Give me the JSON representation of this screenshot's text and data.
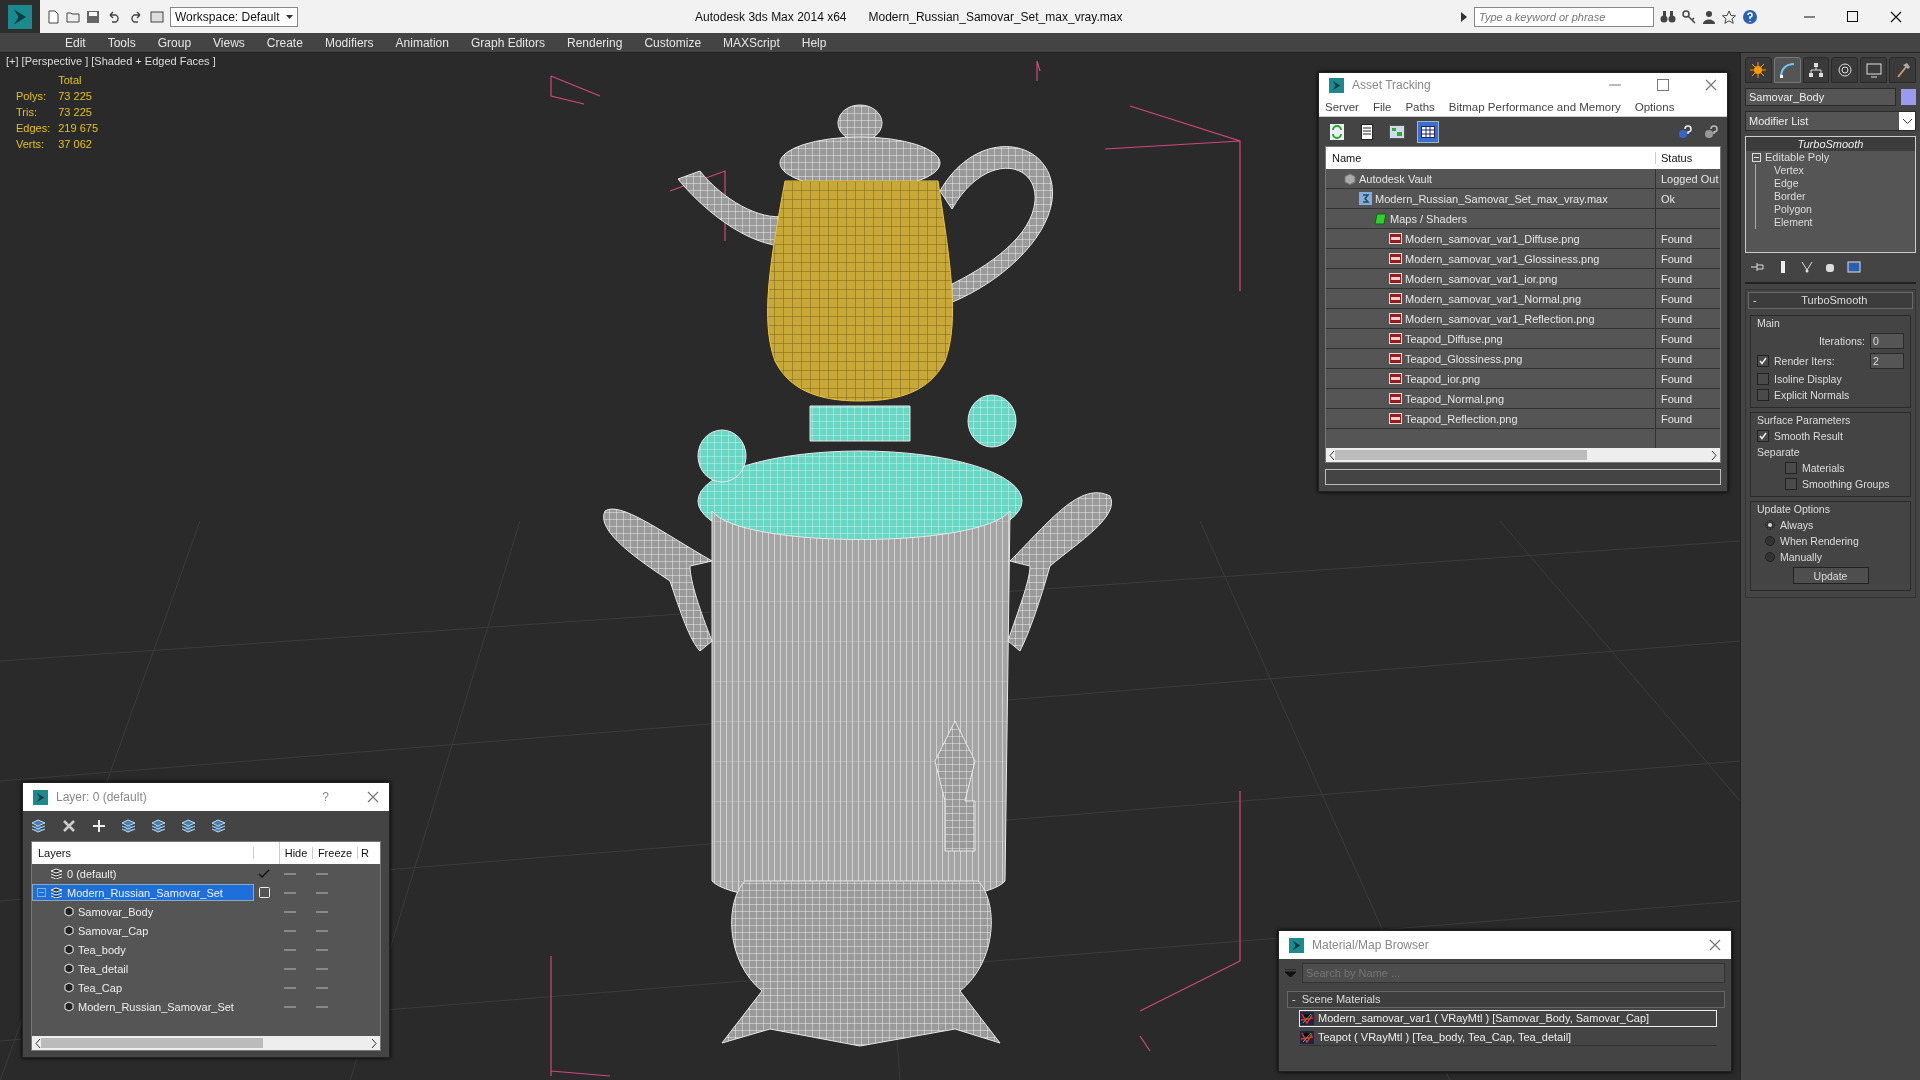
{
  "app": {
    "title": "Autodesk 3ds Max  2014 x64",
    "file": "Modern_Russian_Samovar_Set_max_vray.max",
    "workspace": "Workspace: Default",
    "search_placeholder": "Type a keyword or phrase"
  },
  "menu": [
    "Edit",
    "Tools",
    "Group",
    "Views",
    "Create",
    "Modifiers",
    "Animation",
    "Graph Editors",
    "Rendering",
    "Customize",
    "MAXScript",
    "Help"
  ],
  "viewport": {
    "label": "[+] [Perspective ] [Shaded + Edged Faces ]",
    "stats_header": "Total",
    "stats": [
      {
        "label": "Polys:",
        "value": "73 225"
      },
      {
        "label": "Tris:",
        "value": "73 225"
      },
      {
        "label": "Edges:",
        "value": "219 675"
      },
      {
        "label": "Verts:",
        "value": "37 062"
      }
    ]
  },
  "asset_tracking": {
    "title": "Asset Tracking",
    "menu": [
      "Server",
      "File",
      "Paths",
      "Bitmap Performance and Memory",
      "Options"
    ],
    "columns": [
      "Name",
      "Status"
    ],
    "rows": [
      {
        "name": "Autodesk Vault",
        "status": "Logged Out",
        "kind": "vault",
        "children": [
          {
            "name": "Modern_Russian_Samovar_Set_max_vray.max",
            "status": "Ok",
            "kind": "scene",
            "children": [
              {
                "name": "Maps / Shaders",
                "kind": "folder",
                "children": [
                  {
                    "name": "Modern_samovar_var1_Diffuse.png",
                    "status": "Found",
                    "kind": "png"
                  },
                  {
                    "name": "Modern_samovar_var1_Glossiness.png",
                    "status": "Found",
                    "kind": "png"
                  },
                  {
                    "name": "Modern_samovar_var1_ior.png",
                    "status": "Found",
                    "kind": "png"
                  },
                  {
                    "name": "Modern_samovar_var1_Normal.png",
                    "status": "Found",
                    "kind": "png"
                  },
                  {
                    "name": "Modern_samovar_var1_Reflection.png",
                    "status": "Found",
                    "kind": "png"
                  },
                  {
                    "name": "Teapod_Diffuse.png",
                    "status": "Found",
                    "kind": "png"
                  },
                  {
                    "name": "Teapod_Glossiness.png",
                    "status": "Found",
                    "kind": "png"
                  },
                  {
                    "name": "Teapod_ior.png",
                    "status": "Found",
                    "kind": "png"
                  },
                  {
                    "name": "Teapod_Normal.png",
                    "status": "Found",
                    "kind": "png"
                  },
                  {
                    "name": "Teapod_Reflection.png",
                    "status": "Found",
                    "kind": "png"
                  }
                ]
              }
            ]
          }
        ]
      }
    ]
  },
  "command_panel": {
    "tabs": [
      {
        "selected": false
      },
      {
        "selected": true
      },
      {
        "selected": false
      },
      {
        "selected": false
      },
      {
        "selected": false
      },
      {
        "selected": false
      }
    ],
    "object_name": "Samovar_Body",
    "modifier_list": "Modifier List",
    "stack": [
      {
        "name": "TurboSmooth",
        "kind": "modifier"
      },
      {
        "name": "Editable Poly",
        "kind": "base",
        "expanded": true,
        "children": [
          {
            "name": "Vertex"
          },
          {
            "name": "Edge"
          },
          {
            "name": "Border"
          },
          {
            "name": "Polygon"
          },
          {
            "name": "Element"
          }
        ]
      }
    ],
    "turbosmooth": {
      "title": "TurboSmooth",
      "toggle": "-",
      "main": {
        "title": "Main",
        "iterations_label": "Iterations:",
        "iterations": "0",
        "render_iters": {
          "label": "Render Iters:",
          "checked": true,
          "value": "2"
        },
        "checks": [
          {
            "label": "Isoline Display",
            "checked": false
          },
          {
            "label": "Explicit Normals",
            "checked": false
          }
        ]
      },
      "surface": {
        "title": "Surface Parameters",
        "smooth": {
          "label": "Smooth Result",
          "checked": true
        },
        "separate": "Separate",
        "checks": [
          {
            "label": "Materials",
            "checked": false
          },
          {
            "label": "Smoothing Groups",
            "checked": false
          }
        ]
      },
      "update": {
        "title": "Update Options",
        "options": [
          {
            "label": "Always",
            "selected": true
          },
          {
            "label": "When Rendering",
            "selected": false
          },
          {
            "label": "Manually",
            "selected": false
          }
        ],
        "button": "Update"
      }
    }
  },
  "layers": {
    "title": "Layer: 0 (default)",
    "help": "?",
    "columns": [
      "Layers",
      "Hide",
      "Freeze",
      "R"
    ],
    "rows": [
      {
        "name": "0 (default)",
        "selected": false,
        "current": true
      },
      {
        "name": "Modern_Russian_Samovar_Set",
        "selected": true,
        "current": false,
        "expanded": true,
        "children": [
          {
            "name": "Samovar_Body"
          },
          {
            "name": "Samovar_Cap"
          },
          {
            "name": "Tea_body"
          },
          {
            "name": "Tea_detail"
          },
          {
            "name": "Tea_Cap"
          },
          {
            "name": "Modern_Russian_Samovar_Set"
          }
        ]
      }
    ]
  },
  "material_browser": {
    "title": "Material/Map Browser",
    "search_placeholder": "Search by Name ...",
    "group": {
      "toggle": "-",
      "title": "Scene Materials"
    },
    "items": [
      {
        "text": "Modern_samovar_var1  ( VRayMtl ) [Samovar_Body, Samovar_Cap]",
        "selected": true
      },
      {
        "text": "Teapot  ( VRayMtl ) [Tea_body, Tea_Cap, Tea_detail]",
        "selected": false
      }
    ]
  }
}
